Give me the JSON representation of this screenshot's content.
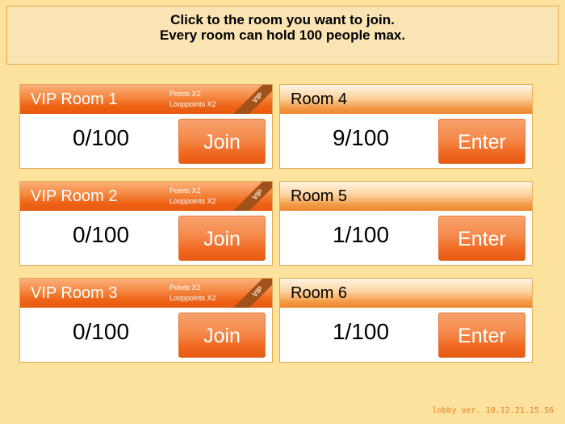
{
  "instructions": {
    "line1": "Click to the room you want to join.",
    "line2": "Every room can hold 100 people max."
  },
  "vip_rooms": [
    {
      "name": "VIP Room 1",
      "perk1": "Points X2",
      "perk2": "Looppoints X2",
      "tag": "VIP",
      "occupancy": "0/100",
      "button": "Join"
    },
    {
      "name": "VIP Room 2",
      "perk1": "Points X2",
      "perk2": "Looppoints X2",
      "tag": "VIP",
      "occupancy": "0/100",
      "button": "Join"
    },
    {
      "name": "VIP Room 3",
      "perk1": "Points X2",
      "perk2": "Looppoints X2",
      "tag": "VIP",
      "occupancy": "0/100",
      "button": "Join"
    }
  ],
  "rooms": [
    {
      "name": "Room 4",
      "occupancy": "9/100",
      "button": "Enter"
    },
    {
      "name": "Room 5",
      "occupancy": "1/100",
      "button": "Enter"
    },
    {
      "name": "Room 6",
      "occupancy": "1/100",
      "button": "Enter"
    }
  ],
  "footer": {
    "version": "lobby ver. 10.12.21.15.56"
  },
  "colors": {
    "background": "#fde29e",
    "accent": "#ee6214",
    "version_text": "#e0801e"
  }
}
